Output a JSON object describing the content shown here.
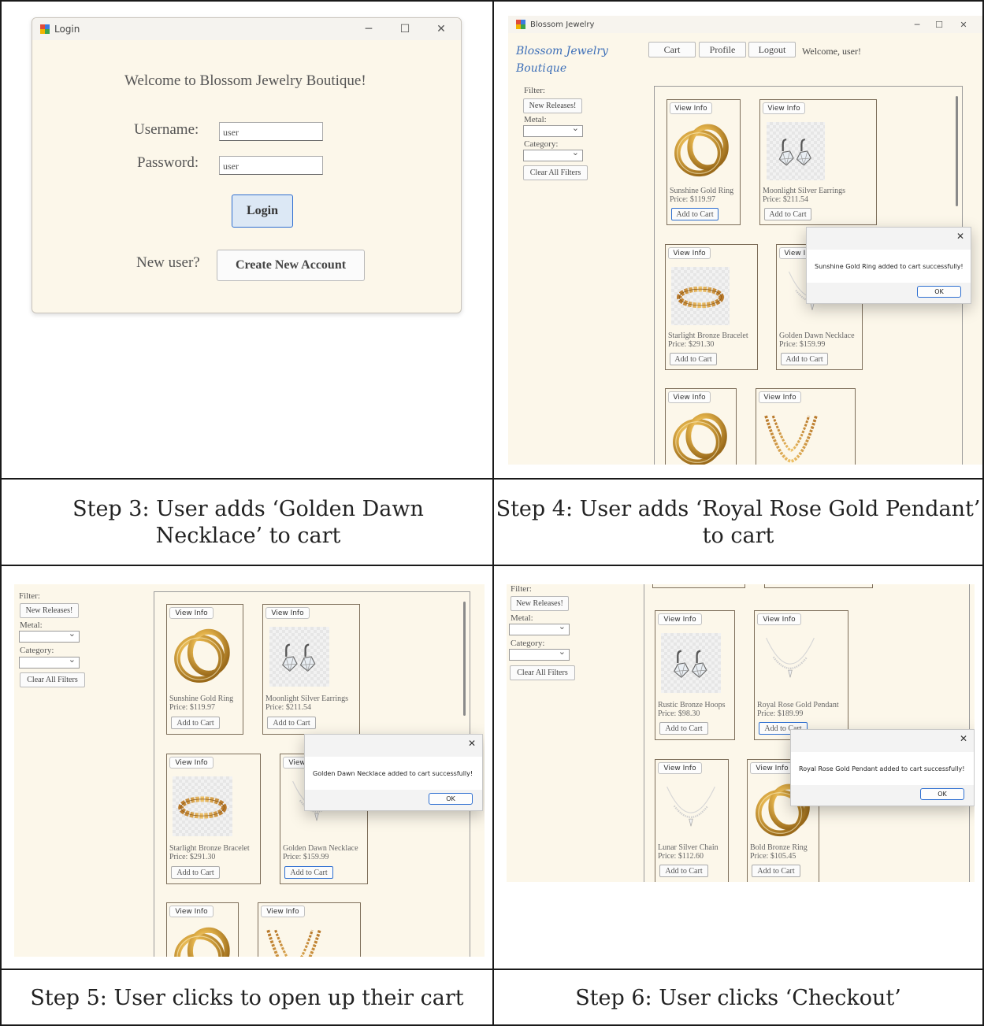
{
  "captions": {
    "step3": "Step 3: User adds ‘Golden Dawn Necklace’ to cart",
    "step4": "Step 4: User adds ‘Royal Rose Gold Pendant’ to cart",
    "step5": "Step 5: User clicks to open up their cart",
    "step6": "Step 6: User clicks ‘Checkout’"
  },
  "login": {
    "window_title": "Login",
    "welcome": "Welcome to Blossom Jewelry Boutique!",
    "username_label": "Username:",
    "username_value": "user",
    "password_label": "Password:",
    "password_value": "user",
    "login_button": "Login",
    "new_user_label": "New user?",
    "create_account_button": "Create New Account"
  },
  "shop": {
    "window_title": "Blossom Jewelry",
    "logo_text": "Blossom Jewelry Boutique",
    "cart_button": "Cart",
    "profile_button": "Profile",
    "logout_button": "Logout",
    "welcome": "Welcome, user!",
    "filter_label": "Filter:",
    "new_releases_button": "New Releases!",
    "metal_label": "Metal:",
    "category_label": "Category:",
    "clear_filters_button": "Clear All Filters",
    "view_info": "View Info",
    "add_to_cart": "Add to Cart",
    "ok_button": "OK"
  },
  "products": {
    "sunshine_ring": {
      "name": "Sunshine Gold Ring",
      "price": "Price: $119.97"
    },
    "moonlight_earrings": {
      "name": "Moonlight Silver Earrings",
      "price": "Price: $211.54"
    },
    "starlight_bracelet": {
      "name": "Starlight Bronze Bracelet",
      "price": "Price: $291.30"
    },
    "golden_necklace": {
      "name": "Golden Dawn Necklace",
      "price": "Price: $159.99"
    },
    "rustic_hoops": {
      "name": "Rustic Bronze Hoops",
      "price": "Price: $98.30"
    },
    "royal_pendant": {
      "name": "Royal Rose Gold Pendant",
      "price": "Price: $189.99"
    },
    "lunar_chain": {
      "name": "Lunar Silver Chain",
      "price": "Price: $112.60"
    },
    "bold_ring": {
      "name": "Bold Bronze Ring",
      "price": "Price: $105.45"
    }
  },
  "dialogs": {
    "sunshine": "Sunshine Gold Ring added to cart successfully!",
    "golden": "Golden Dawn Necklace added to cart successfully!",
    "royal": "Royal Rose Gold Pendant added to cart successfully!"
  },
  "icons": [
    "app-icon",
    "minimize-icon",
    "maximize-icon",
    "close-icon",
    "chevron-down-icon"
  ],
  "colors": {
    "app_background": "#fcf7ea",
    "focus_blue": "#2e6fd1",
    "gold": "#d8a53a",
    "logo_blue": "#3d6fb8"
  }
}
